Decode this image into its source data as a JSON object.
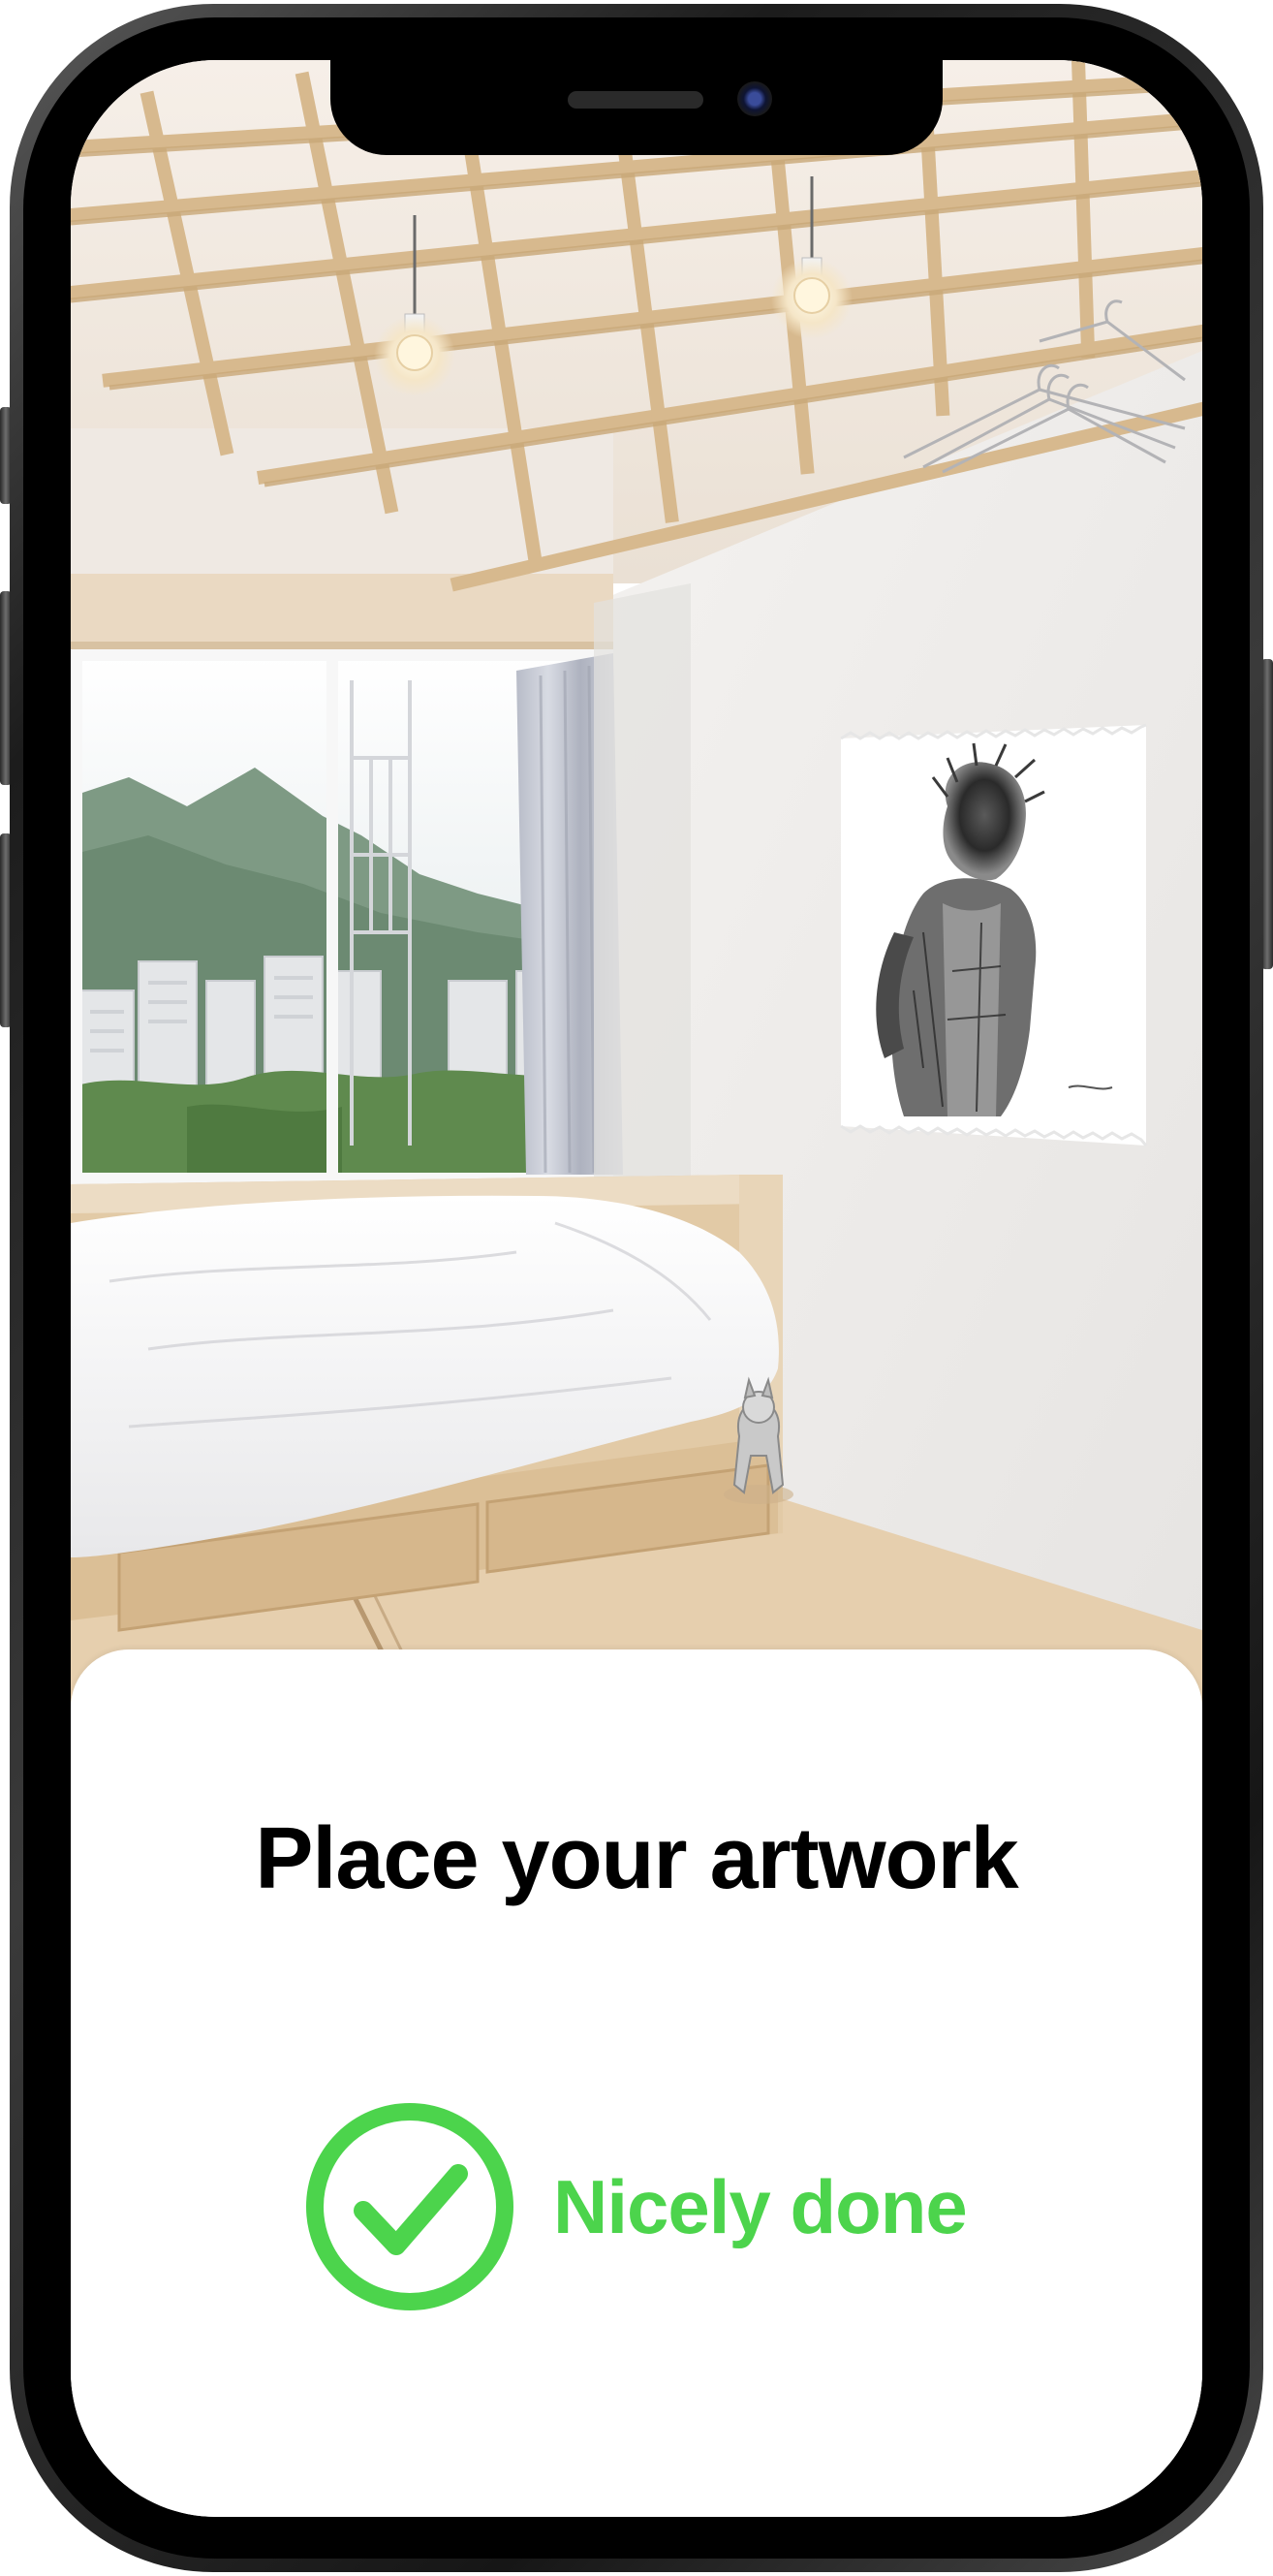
{
  "device": "iphone",
  "colors": {
    "success": "#4cd44c",
    "title": "#000000",
    "sheet_background": "#ffffff"
  },
  "ar_view": {
    "artwork_placed": true
  },
  "sheet": {
    "title": "Place your artwork",
    "status": {
      "icon": "checkmark-circle-icon",
      "label": "Nicely done"
    }
  }
}
